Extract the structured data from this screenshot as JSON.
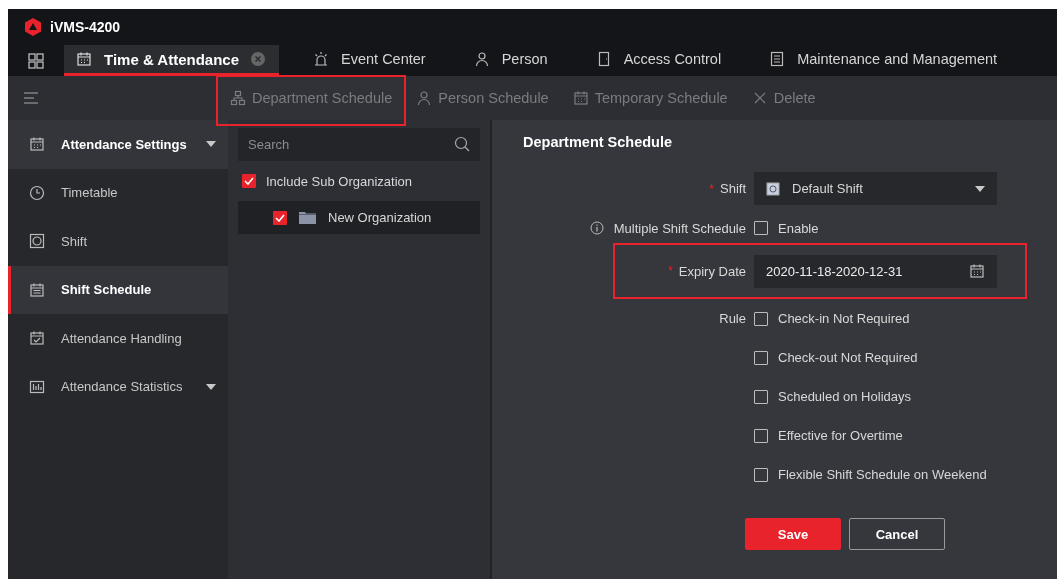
{
  "app": {
    "title": "iVMS-4200"
  },
  "tabs": [
    {
      "label": "Time & Attendance",
      "selected": true,
      "closable": true
    },
    {
      "label": "Event Center",
      "selected": false,
      "closable": false
    },
    {
      "label": "Person",
      "selected": false,
      "closable": false
    },
    {
      "label": "Access Control",
      "selected": false,
      "closable": false
    },
    {
      "label": "Maintenance and Management",
      "selected": false,
      "closable": false
    }
  ],
  "toolbar": [
    {
      "label": "Department Schedule",
      "disabled": true,
      "highlighted": true
    },
    {
      "label": "Person Schedule",
      "disabled": true,
      "highlighted": false
    },
    {
      "label": "Temporary Schedule",
      "disabled": true,
      "highlighted": false
    },
    {
      "label": "Delete",
      "disabled": true,
      "highlighted": false
    }
  ],
  "sidebar": {
    "items": [
      {
        "kind": "group",
        "label": "Attendance Settings",
        "selected": false,
        "expanded": true
      },
      {
        "kind": "item",
        "label": "Timetable",
        "selected": false
      },
      {
        "kind": "item",
        "label": "Shift",
        "selected": false
      },
      {
        "kind": "item",
        "label": "Shift Schedule",
        "selected": true
      },
      {
        "kind": "item",
        "label": "Attendance Handling",
        "selected": false
      },
      {
        "kind": "group",
        "label": "Attendance Statistics",
        "selected": false,
        "expanded": false
      }
    ]
  },
  "tree": {
    "search": {
      "placeholder": "Search"
    },
    "include_sub": {
      "label": "Include Sub Organization",
      "checked": true
    },
    "nodes": [
      {
        "label": "New Organization",
        "checked": true,
        "selected": true
      }
    ]
  },
  "form": {
    "title": "Department Schedule",
    "shift": {
      "label": "Shift",
      "required_mark": "*",
      "value": "Default Shift"
    },
    "multiple": {
      "label": "Multiple Shift Schedule",
      "option": "Enable",
      "checked": false
    },
    "expiry": {
      "label": "Expiry Date",
      "required_mark": "*",
      "value": "2020-11-18-2020-12-31",
      "highlighted": true
    },
    "rule": {
      "label": "Rule",
      "options": [
        {
          "label": "Check-in Not Required",
          "checked": false
        },
        {
          "label": "Check-out Not Required",
          "checked": false
        },
        {
          "label": "Scheduled on Holidays",
          "checked": false
        },
        {
          "label": "Effective for Overtime",
          "checked": false
        },
        {
          "label": "Flexible Shift Schedule on Weekend",
          "checked": false
        }
      ]
    },
    "buttons": [
      {
        "label": "Save",
        "kind": "primary"
      },
      {
        "label": "Cancel",
        "kind": "secondary"
      }
    ]
  }
}
